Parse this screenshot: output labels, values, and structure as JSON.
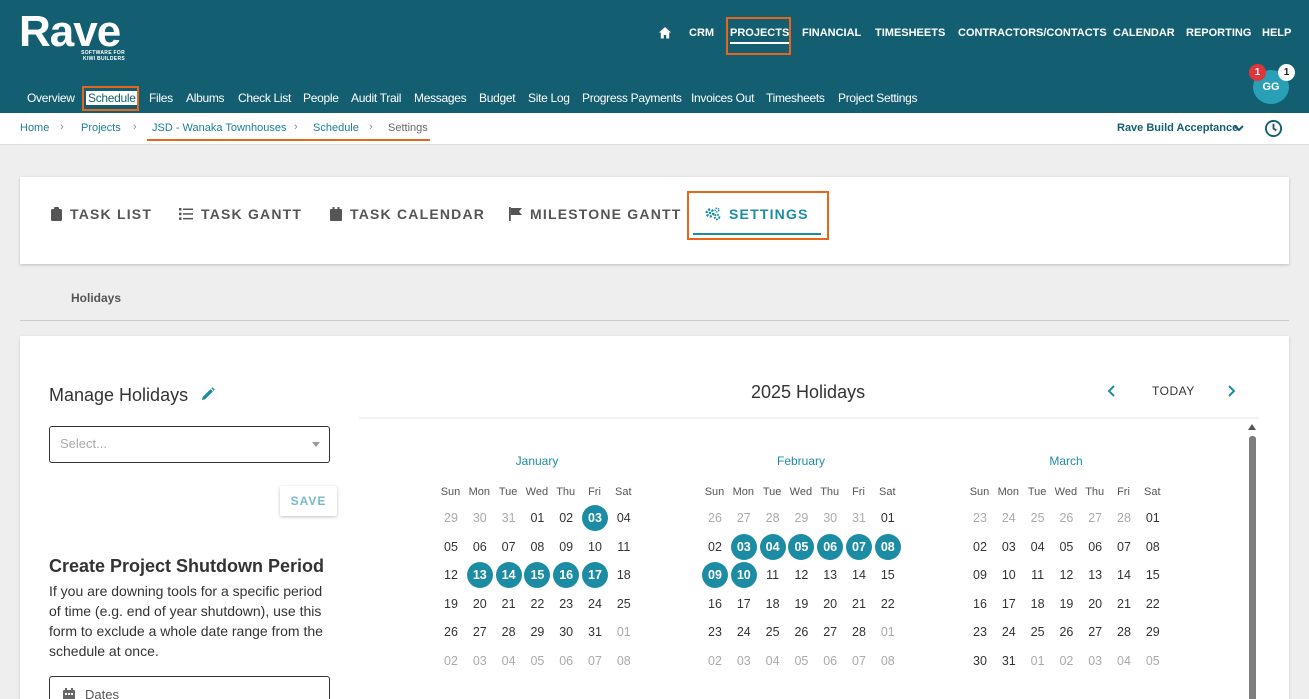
{
  "brand": {
    "name": "Rave",
    "tagline_1": "SOFTWARE FOR",
    "tagline_2": "KIWI BUILDERS"
  },
  "top_nav": [
    {
      "label": "CRM"
    },
    {
      "label": "PROJECTS"
    },
    {
      "label": "FINANCIAL"
    },
    {
      "label": "TIMESHEETS"
    },
    {
      "label": "CONTRACTORS/CONTACTS"
    },
    {
      "label": "CALENDAR"
    },
    {
      "label": "REPORTING"
    },
    {
      "label": "HELP"
    }
  ],
  "sub_nav": [
    {
      "label": "Overview"
    },
    {
      "label": "Schedule"
    },
    {
      "label": "Files"
    },
    {
      "label": "Albums"
    },
    {
      "label": "Check List"
    },
    {
      "label": "People"
    },
    {
      "label": "Audit Trail"
    },
    {
      "label": "Messages"
    },
    {
      "label": "Budget"
    },
    {
      "label": "Site Log"
    },
    {
      "label": "Progress Payments"
    },
    {
      "label": "Invoices Out"
    },
    {
      "label": "Timesheets"
    },
    {
      "label": "Project Settings"
    }
  ],
  "user": {
    "initials": "GG",
    "notifications": "1",
    "messages": "1"
  },
  "breadcrumb": [
    "Home",
    "Projects",
    "JSD - Wanaka Townhouses",
    "Schedule",
    "Settings"
  ],
  "build_select": "Rave Build Acceptance",
  "tabs": [
    {
      "label": "TASK LIST"
    },
    {
      "label": "TASK GANTT"
    },
    {
      "label": "TASK CALENDAR"
    },
    {
      "label": "MILESTONE GANTT"
    },
    {
      "label": "SETTINGS"
    }
  ],
  "section_label": "Holidays",
  "manage": {
    "title": "Manage Holidays",
    "select_placeholder": "Select...",
    "save_label": "SAVE"
  },
  "shutdown": {
    "title": "Create Project Shutdown Period",
    "description": "If you are downing tools for a specific period of time (e.g. end of year shutdown), use this form to exclude a whole date range from the schedule at once.",
    "dates_placeholder": "Dates"
  },
  "calendar": {
    "year_title": "2025 Holidays",
    "today_label": "TODAY",
    "weekdays": [
      "Sun",
      "Mon",
      "Tue",
      "Wed",
      "Thu",
      "Fri",
      "Sat"
    ],
    "months": [
      {
        "name": "January",
        "weeks": [
          [
            [
              "29",
              "out"
            ],
            [
              "30",
              "out"
            ],
            [
              "31",
              "out"
            ],
            [
              "01",
              ""
            ],
            [
              "02",
              ""
            ],
            [
              "03",
              "hol"
            ],
            [
              "04",
              ""
            ]
          ],
          [
            [
              "05",
              ""
            ],
            [
              "06",
              ""
            ],
            [
              "07",
              ""
            ],
            [
              "08",
              ""
            ],
            [
              "09",
              ""
            ],
            [
              "10",
              ""
            ],
            [
              "11",
              ""
            ]
          ],
          [
            [
              "12",
              ""
            ],
            [
              "13",
              "hol"
            ],
            [
              "14",
              "hol"
            ],
            [
              "15",
              "hol"
            ],
            [
              "16",
              "hol"
            ],
            [
              "17",
              "hol"
            ],
            [
              "18",
              ""
            ]
          ],
          [
            [
              "19",
              ""
            ],
            [
              "20",
              ""
            ],
            [
              "21",
              ""
            ],
            [
              "22",
              ""
            ],
            [
              "23",
              ""
            ],
            [
              "24",
              ""
            ],
            [
              "25",
              ""
            ]
          ],
          [
            [
              "26",
              ""
            ],
            [
              "27",
              ""
            ],
            [
              "28",
              ""
            ],
            [
              "29",
              ""
            ],
            [
              "30",
              ""
            ],
            [
              "31",
              ""
            ],
            [
              "01",
              "out"
            ]
          ],
          [
            [
              "02",
              "out"
            ],
            [
              "03",
              "out"
            ],
            [
              "04",
              "out"
            ],
            [
              "05",
              "out"
            ],
            [
              "06",
              "out"
            ],
            [
              "07",
              "out"
            ],
            [
              "08",
              "out"
            ]
          ]
        ]
      },
      {
        "name": "February",
        "weeks": [
          [
            [
              "26",
              "out"
            ],
            [
              "27",
              "out"
            ],
            [
              "28",
              "out"
            ],
            [
              "29",
              "out"
            ],
            [
              "30",
              "out"
            ],
            [
              "31",
              "out"
            ],
            [
              "01",
              ""
            ]
          ],
          [
            [
              "02",
              ""
            ],
            [
              "03",
              "hol"
            ],
            [
              "04",
              "hol"
            ],
            [
              "05",
              "hol"
            ],
            [
              "06",
              "hol"
            ],
            [
              "07",
              "hol"
            ],
            [
              "08",
              "hol"
            ]
          ],
          [
            [
              "09",
              "hol"
            ],
            [
              "10",
              "hol"
            ],
            [
              "11",
              ""
            ],
            [
              "12",
              ""
            ],
            [
              "13",
              ""
            ],
            [
              "14",
              ""
            ],
            [
              "15",
              ""
            ]
          ],
          [
            [
              "16",
              ""
            ],
            [
              "17",
              ""
            ],
            [
              "18",
              ""
            ],
            [
              "19",
              ""
            ],
            [
              "20",
              ""
            ],
            [
              "21",
              ""
            ],
            [
              "22",
              ""
            ]
          ],
          [
            [
              "23",
              ""
            ],
            [
              "24",
              ""
            ],
            [
              "25",
              ""
            ],
            [
              "26",
              ""
            ],
            [
              "27",
              ""
            ],
            [
              "28",
              ""
            ],
            [
              "01",
              "out"
            ]
          ],
          [
            [
              "02",
              "out"
            ],
            [
              "03",
              "out"
            ],
            [
              "04",
              "out"
            ],
            [
              "05",
              "out"
            ],
            [
              "06",
              "out"
            ],
            [
              "07",
              "out"
            ],
            [
              "08",
              "out"
            ]
          ]
        ]
      },
      {
        "name": "March",
        "weeks": [
          [
            [
              "23",
              "out"
            ],
            [
              "24",
              "out"
            ],
            [
              "25",
              "out"
            ],
            [
              "26",
              "out"
            ],
            [
              "27",
              "out"
            ],
            [
              "28",
              "out"
            ],
            [
              "01",
              ""
            ]
          ],
          [
            [
              "02",
              ""
            ],
            [
              "03",
              ""
            ],
            [
              "04",
              ""
            ],
            [
              "05",
              ""
            ],
            [
              "06",
              ""
            ],
            [
              "07",
              ""
            ],
            [
              "08",
              ""
            ]
          ],
          [
            [
              "09",
              ""
            ],
            [
              "10",
              ""
            ],
            [
              "11",
              ""
            ],
            [
              "12",
              ""
            ],
            [
              "13",
              ""
            ],
            [
              "14",
              ""
            ],
            [
              "15",
              ""
            ]
          ],
          [
            [
              "16",
              ""
            ],
            [
              "17",
              ""
            ],
            [
              "18",
              ""
            ],
            [
              "19",
              ""
            ],
            [
              "20",
              ""
            ],
            [
              "21",
              ""
            ],
            [
              "22",
              ""
            ]
          ],
          [
            [
              "23",
              ""
            ],
            [
              "24",
              ""
            ],
            [
              "25",
              ""
            ],
            [
              "26",
              ""
            ],
            [
              "27",
              ""
            ],
            [
              "28",
              ""
            ],
            [
              "29",
              ""
            ]
          ],
          [
            [
              "30",
              ""
            ],
            [
              "31",
              ""
            ],
            [
              "01",
              "out"
            ],
            [
              "02",
              "out"
            ],
            [
              "03",
              "out"
            ],
            [
              "04",
              "out"
            ],
            [
              "05",
              "out"
            ]
          ]
        ]
      }
    ]
  },
  "colors": {
    "header": "#135f71",
    "accent": "#1c8ca5",
    "highlight": "#e8661c"
  }
}
